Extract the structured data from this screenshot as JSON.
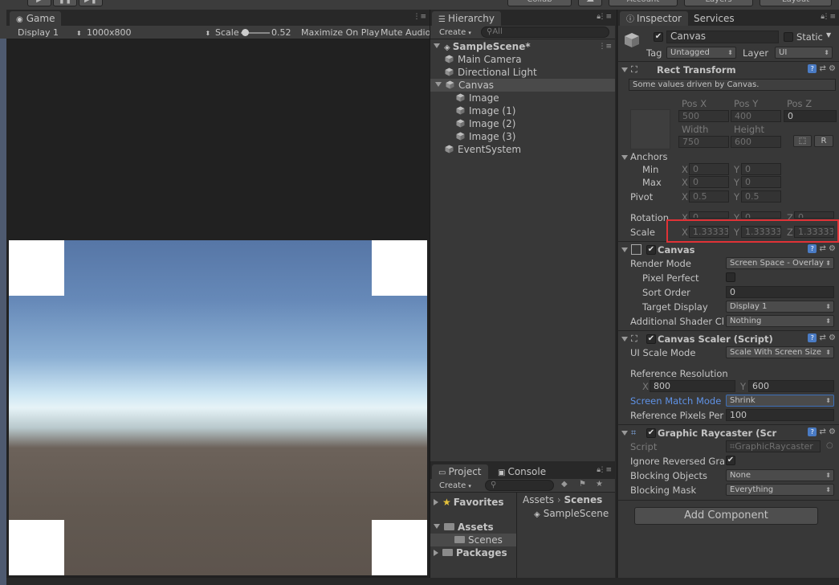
{
  "toolbar": {
    "collab": "Collab",
    "account": "Account",
    "layers": "Layers",
    "layout": "Layout"
  },
  "game": {
    "tab": "Game",
    "display": "Display 1",
    "resolution": "1000x800",
    "scale_label": "Scale",
    "scale_value": "0.52",
    "maximize": "Maximize On Play",
    "mute": "Mute Audio"
  },
  "hierarchy": {
    "tab": "Hierarchy",
    "create": "Create",
    "search_placeholder": "All",
    "scene": "SampleScene*",
    "items": [
      {
        "label": "Main Camera",
        "indent": 1
      },
      {
        "label": "Directional Light",
        "indent": 1
      },
      {
        "label": "Canvas",
        "indent": 1
      },
      {
        "label": "Image",
        "indent": 2
      },
      {
        "label": "Image (1)",
        "indent": 2
      },
      {
        "label": "Image (2)",
        "indent": 2
      },
      {
        "label": "Image (3)",
        "indent": 2
      },
      {
        "label": "EventSystem",
        "indent": 1
      }
    ]
  },
  "project": {
    "tab_project": "Project",
    "tab_console": "Console",
    "create": "Create",
    "favorites": "Favorites",
    "assets": "Assets",
    "scenes": "Scenes",
    "packages": "Packages",
    "breadcrumb_assets": "Assets",
    "breadcrumb_scenes": "Scenes",
    "file": "SampleScene"
  },
  "inspector": {
    "tab": "Inspector",
    "tab_services": "Services",
    "object_name": "Canvas",
    "static_label": "Static",
    "tag_label": "Tag",
    "tag_value": "Untagged",
    "layer_label": "Layer",
    "layer_value": "UI",
    "rect": {
      "title": "Rect Transform",
      "note": "Some values driven by Canvas.",
      "posx_label": "Pos X",
      "posy_label": "Pos Y",
      "posz_label": "Pos Z",
      "posx": "500",
      "posy": "400",
      "posz": "0",
      "width_label": "Width",
      "height_label": "Height",
      "width": "750",
      "height": "600",
      "r_button": "R",
      "anchors": "Anchors",
      "min": "Min",
      "max": "Max",
      "x": "X",
      "y": "Y",
      "z": "Z",
      "min_x": "0",
      "min_y": "0",
      "max_x": "0",
      "max_y": "0",
      "pivot": "Pivot",
      "pivot_x": "0.5",
      "pivot_y": "0.5",
      "rotation": "Rotation",
      "rot_x": "0",
      "rot_y": "0",
      "rot_z": "0",
      "scale": "Scale",
      "scale_x": "1.33333",
      "scale_y": "1.33333",
      "scale_z": "1.33333"
    },
    "canvas": {
      "title": "Canvas",
      "render_mode_label": "Render Mode",
      "render_mode": "Screen Space - Overlay",
      "pixel_perfect_label": "Pixel Perfect",
      "sort_order_label": "Sort Order",
      "sort_order": "0",
      "target_display_label": "Target Display",
      "target_display": "Display 1",
      "shader_label": "Additional Shader Cl",
      "shader_value": "Nothing"
    },
    "scaler": {
      "title": "Canvas Scaler (Script)",
      "ui_scale_label": "UI Scale Mode",
      "ui_scale": "Scale With Screen Size",
      "ref_res_label": "Reference Resolution",
      "ref_x": "800",
      "ref_y": "600",
      "match_label": "Screen Match Mode",
      "match": "Shrink",
      "ppu_label": "Reference Pixels Per",
      "ppu": "100"
    },
    "raycaster": {
      "title": "Graphic Raycaster (Scr",
      "script_label": "Script",
      "script_value": "GraphicRaycaster",
      "ignore_label": "Ignore Reversed Gra",
      "blocking_objects_label": "Blocking Objects",
      "blocking_objects": "None",
      "blocking_mask_label": "Blocking Mask",
      "blocking_mask": "Everything"
    },
    "add_component": "Add Component"
  },
  "colors": {
    "highlight": "#e03236",
    "accent_blue": "#4a7bc4",
    "match_label": "#5f92e6"
  }
}
